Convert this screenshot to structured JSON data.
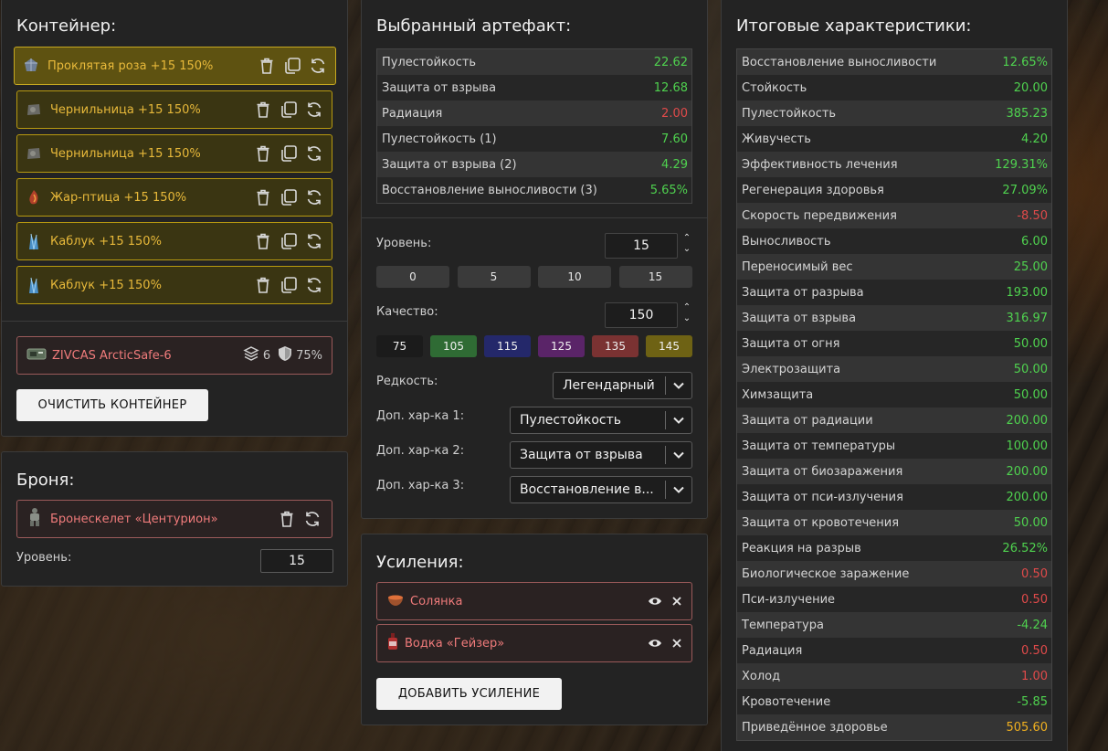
{
  "container": {
    "title": "Контейнер:",
    "artifacts": [
      {
        "name": "Проклятая роза +15 150%",
        "icon": "rose-gem-icon",
        "selected": true
      },
      {
        "name": "Чернильница +15 150%",
        "icon": "inkwell-gem-icon",
        "selected": false
      },
      {
        "name": "Чернильница +15 150%",
        "icon": "inkwell-gem-icon",
        "selected": false
      },
      {
        "name": "Жар-птица +15 150%",
        "icon": "firebird-gem-icon",
        "selected": false
      },
      {
        "name": "Каблук +15 150%",
        "icon": "heel-crystal-icon",
        "selected": false
      },
      {
        "name": "Каблук +15 150%",
        "icon": "heel-crystal-icon",
        "selected": false
      }
    ],
    "item": {
      "name": "ZIVCAS ArcticSafe-6",
      "slots": "6",
      "protection": "75%"
    },
    "clear_button": "ОЧИСТИТЬ КОНТЕЙНЕР"
  },
  "armor": {
    "title": "Броня:",
    "item_name": "Бронескелет «Центурион»",
    "level_label": "Уровень:",
    "level_value": "15"
  },
  "artifact": {
    "title": "Выбранный артефакт:",
    "stats": [
      {
        "name": "Пулестойкость",
        "value": "22.62",
        "color": "green"
      },
      {
        "name": "Защита от взрыва",
        "value": "12.68",
        "color": "green"
      },
      {
        "name": "Радиация",
        "value": "2.00",
        "color": "red"
      },
      {
        "name": "Пулестойкость (1)",
        "value": "7.60",
        "color": "green"
      },
      {
        "name": "Защита от взрыва (2)",
        "value": "4.29",
        "color": "green"
      },
      {
        "name": "Восстановление выносливости (3)",
        "value": "5.65%",
        "color": "green"
      }
    ],
    "level_label": "Уровень:",
    "level_value": "15",
    "level_presets": [
      "0",
      "5",
      "10",
      "15"
    ],
    "quality_label": "Качество:",
    "quality_value": "150",
    "quality_presets": [
      {
        "label": "75",
        "color": "#1b1b1b"
      },
      {
        "label": "105",
        "color": "#2f6b34"
      },
      {
        "label": "115",
        "color": "#24286a"
      },
      {
        "label": "125",
        "color": "#5a2468"
      },
      {
        "label": "135",
        "color": "#7a3232"
      },
      {
        "label": "145",
        "color": "#6e6214"
      }
    ],
    "rarity_label": "Редкость:",
    "rarity_value": "Легендарный",
    "extra1_label": "Доп. хар-ка 1:",
    "extra1_value": "Пулестойкость",
    "extra2_label": "Доп. хар-ка 2:",
    "extra2_value": "Защита от взрыва",
    "extra3_label": "Доп. хар-ка 3:",
    "extra3_value": "Восстановление в..."
  },
  "boosts": {
    "title": "Усиления:",
    "items": [
      {
        "name": "Солянка",
        "icon": "soup-bowl-icon"
      },
      {
        "name": "Водка «Гейзер»",
        "icon": "bottle-icon"
      }
    ],
    "add_button": "ДОБАВИТЬ УСИЛЕНИЕ"
  },
  "totals": {
    "title": "Итоговые характеристики:",
    "stats": [
      {
        "name": "Восстановление выносливости",
        "value": "12.65%",
        "color": "green"
      },
      {
        "name": "Стойкость",
        "value": "20.00",
        "color": "green"
      },
      {
        "name": "Пулестойкость",
        "value": "385.23",
        "color": "green"
      },
      {
        "name": "Живучесть",
        "value": "4.20",
        "color": "green"
      },
      {
        "name": "Эффективность лечения",
        "value": "129.31%",
        "color": "green"
      },
      {
        "name": "Регенерация здоровья",
        "value": "27.09%",
        "color": "green"
      },
      {
        "name": "Скорость передвижения",
        "value": "-8.50",
        "color": "red"
      },
      {
        "name": "Выносливость",
        "value": "6.00",
        "color": "green"
      },
      {
        "name": "Переносимый вес",
        "value": "25.00",
        "color": "green"
      },
      {
        "name": "Защита от разрыва",
        "value": "193.00",
        "color": "green"
      },
      {
        "name": "Защита от взрыва",
        "value": "316.97",
        "color": "green"
      },
      {
        "name": "Защита от огня",
        "value": "50.00",
        "color": "green"
      },
      {
        "name": "Электрозащита",
        "value": "50.00",
        "color": "green"
      },
      {
        "name": "Химзащита",
        "value": "50.00",
        "color": "green"
      },
      {
        "name": "Защита от радиации",
        "value": "200.00",
        "color": "green"
      },
      {
        "name": "Защита от температуры",
        "value": "100.00",
        "color": "green"
      },
      {
        "name": "Защита от биозаражения",
        "value": "200.00",
        "color": "green"
      },
      {
        "name": "Защита от пси-излучения",
        "value": "200.00",
        "color": "green"
      },
      {
        "name": "Защита от кровотечения",
        "value": "50.00",
        "color": "green"
      },
      {
        "name": "Реакция на разрыв",
        "value": "26.52%",
        "color": "green"
      },
      {
        "name": "Биологическое заражение",
        "value": "0.50",
        "color": "red"
      },
      {
        "name": "Пси-излучение",
        "value": "0.50",
        "color": "red"
      },
      {
        "name": "Температура",
        "value": "-4.24",
        "color": "green"
      },
      {
        "name": "Радиация",
        "value": "0.50",
        "color": "red"
      },
      {
        "name": "Холод",
        "value": "1.00",
        "color": "red"
      },
      {
        "name": "Кровотечение",
        "value": "-5.85",
        "color": "green"
      },
      {
        "name": "Приведённое здоровье",
        "value": "505.60",
        "color": "gold"
      }
    ]
  }
}
